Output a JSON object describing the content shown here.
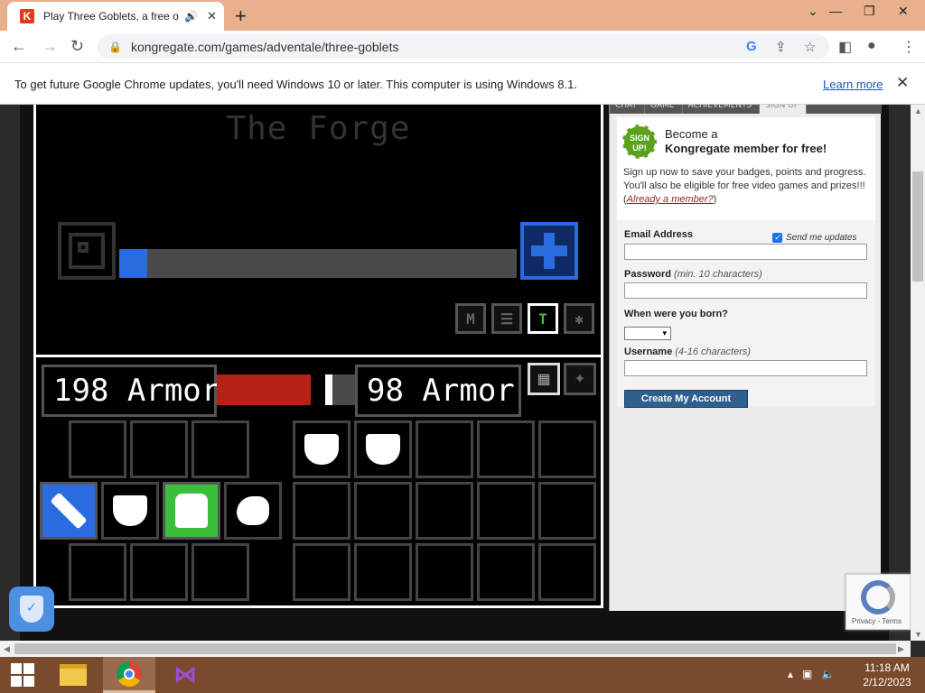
{
  "browser": {
    "tab_title": "Play Three Goblets, a free on",
    "tab_favicon": "K",
    "new_tab": "+",
    "url": "kongregate.com/games/adventale/three-goblets",
    "infobar_message": "To get future Google Chrome updates, you'll need Windows 10 or later. This computer is using Windows 8.1.",
    "infobar_link": "Learn more"
  },
  "game": {
    "forge_title": "The Forge",
    "forge_progress": 0.07,
    "armor_left": "198 Armor",
    "armor_right": "98 Armor",
    "player_health": 0.78,
    "colors": {
      "blue": "#2a6bde",
      "green": "#3bbf3b",
      "red": "#b52218"
    }
  },
  "sidebar": {
    "tabs": [
      "CHAT",
      "GAME",
      "ACHIEVEMENTS",
      "SIGN UP"
    ],
    "badge": "SIGN UP!",
    "become": "Become a",
    "member_title": "Kongregate member for free!",
    "description": "Sign up now to save your badges, points and progress. You'll also be eligible for free video games and prizes!!! (",
    "already_member": "Already a member?",
    "desc_end": ")",
    "email_label": "Email Address",
    "send_updates": "Send me updates",
    "password_label": "Password",
    "password_hint": "(min. 10 characters)",
    "birth_label": "When were you born?",
    "username_label": "Username",
    "username_hint": "(4-16 characters)",
    "create_button": "Create My Account"
  },
  "recaptcha": {
    "text": "Privacy - Terms"
  },
  "taskbar": {
    "time": "11:18 AM",
    "date": "2/12/2023"
  }
}
